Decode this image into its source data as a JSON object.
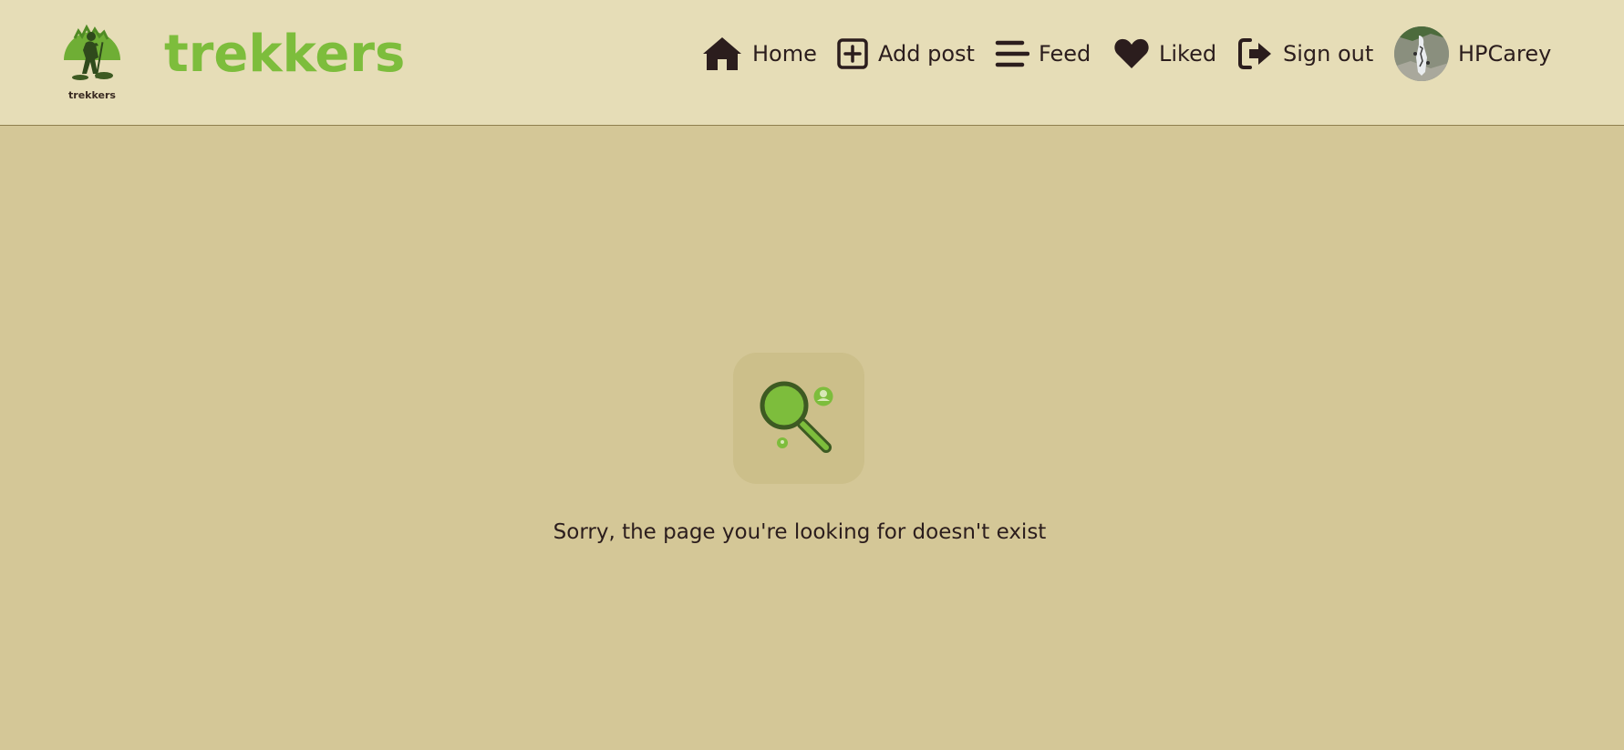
{
  "navbar": {
    "logo_caption": "trekkers",
    "brand": "trekkers",
    "items": [
      {
        "label": "Home",
        "icon": "home-icon"
      },
      {
        "label": "Add post",
        "icon": "plus-square-icon"
      },
      {
        "label": "Feed",
        "icon": "stream-icon"
      },
      {
        "label": "Liked",
        "icon": "heart-icon"
      },
      {
        "label": "Sign out",
        "icon": "sign-out-icon"
      }
    ],
    "profile": {
      "username": "HPCarey",
      "avatar": "avatar-photo"
    }
  },
  "main": {
    "icon": "magnifying-glass-icon",
    "message": "Sorry, the page you're looking for doesn't exist"
  },
  "colors": {
    "navbar_bg": "#e6ddb7",
    "page_bg": "#d4c797",
    "brand_green": "#7dbd3c",
    "text_dark": "#2b1d1d"
  }
}
